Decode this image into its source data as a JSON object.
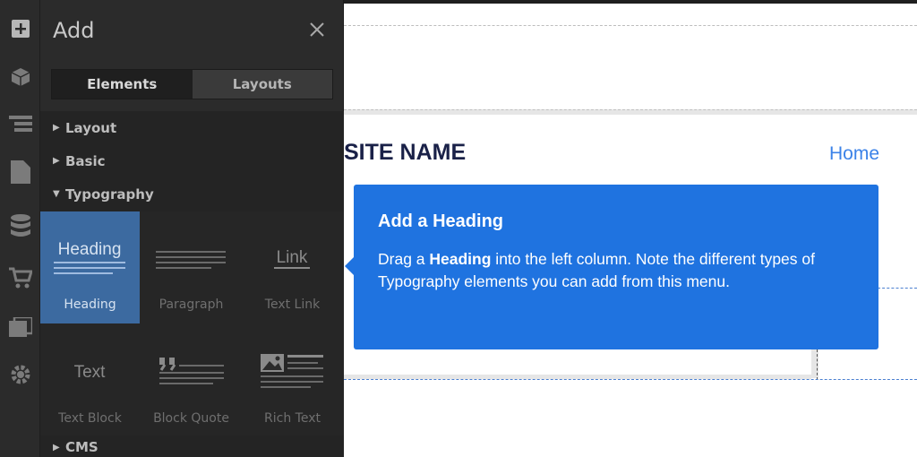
{
  "panel": {
    "title": "Add",
    "tabs": [
      {
        "label": "Elements",
        "active": true
      },
      {
        "label": "Layouts",
        "active": false
      }
    ],
    "sections": [
      {
        "label": "Layout",
        "expanded": false
      },
      {
        "label": "Basic",
        "expanded": false
      },
      {
        "label": "Typography",
        "expanded": true
      },
      {
        "label": "CMS",
        "expanded": false
      }
    ],
    "typography_elements": [
      {
        "label": "Heading",
        "icon": "heading-icon",
        "selected": true
      },
      {
        "label": "Paragraph",
        "icon": "paragraph-icon",
        "selected": false
      },
      {
        "label": "Text Link",
        "icon": "link-icon",
        "selected": false
      },
      {
        "label": "Text Block",
        "icon": "text-icon",
        "selected": false
      },
      {
        "label": "Block Quote",
        "icon": "quote-icon",
        "selected": false
      },
      {
        "label": "Rich Text",
        "icon": "rich-text-icon",
        "selected": false
      }
    ],
    "heading_glyph": "Heading",
    "link_glyph": "Link",
    "text_glyph": "Text"
  },
  "rail": {
    "icons": [
      "add-icon",
      "box-icon",
      "navigator-icon",
      "pages-icon",
      "cms-icon",
      "ecommerce-icon",
      "assets-icon",
      "settings-icon"
    ]
  },
  "canvas": {
    "site_name": "SITE NAME",
    "nav_home": "Home"
  },
  "tooltip": {
    "title": "Add a Heading",
    "body_prefix": "Drag a ",
    "body_bold": "Heading",
    "body_suffix": " into the left column. Note the different types of Typography elements you can add from this menu."
  },
  "colors": {
    "panel_bg": "#2b2b2b",
    "selected_tile": "#3c6aa0",
    "tooltip_bg": "#1f73e0",
    "site_name": "#1a2148",
    "nav_link": "#3b82e8"
  }
}
